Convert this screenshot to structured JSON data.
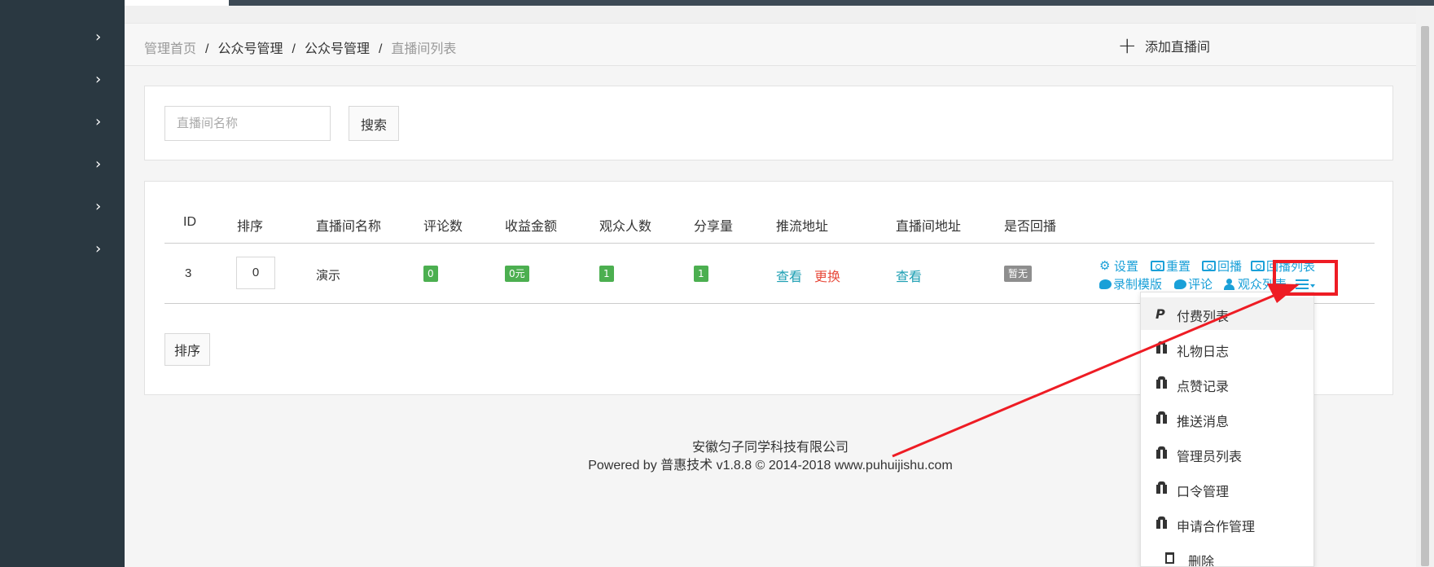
{
  "sidebar": {
    "items": [
      "›",
      "›",
      "›",
      "›",
      "›",
      "›"
    ]
  },
  "breadcrumb": {
    "items": [
      "管理首页",
      "公众号管理",
      "公众号管理",
      "直播间列表"
    ],
    "separator": "/"
  },
  "header": {
    "add_label": "添加直播间"
  },
  "search": {
    "placeholder": "直播间名称",
    "button_label": "搜索"
  },
  "table": {
    "headers": [
      "ID",
      "排序",
      "直播间名称",
      "评论数",
      "收益金额",
      "观众人数",
      "分享量",
      "推流地址",
      "直播间地址",
      "是否回播"
    ],
    "rows": [
      {
        "id": "3",
        "sort": "0",
        "name": "演示",
        "comments": "0",
        "income": "0元",
        "viewers": "1",
        "shares": "1",
        "push_view": "查看",
        "push_change": "更换",
        "room_view": "查看",
        "replay": "暂无",
        "ops_line1": [
          "设置",
          "重置",
          "回播",
          "回播列表"
        ],
        "ops_line2": [
          "录制模版",
          "评论",
          "观众列表"
        ]
      }
    ],
    "sort_button": "排序"
  },
  "dropdown": {
    "items": [
      "付费列表",
      "礼物日志",
      "点赞记录",
      "推送消息",
      "管理员列表",
      "口令管理",
      "申请合作管理",
      "删除"
    ]
  },
  "footer": {
    "company": "安徽匀子同学科技有限公司",
    "powered": "Powered by 普惠技术 v1.8.8 © 2014-2018 www.puhuijishu.com"
  },
  "colors": {
    "sidebar": "#2a3841",
    "link": "#1e9fb3",
    "ops": "#1aa0d8",
    "badge_green": "#4caf50",
    "annotation_red": "#ee1c24"
  }
}
